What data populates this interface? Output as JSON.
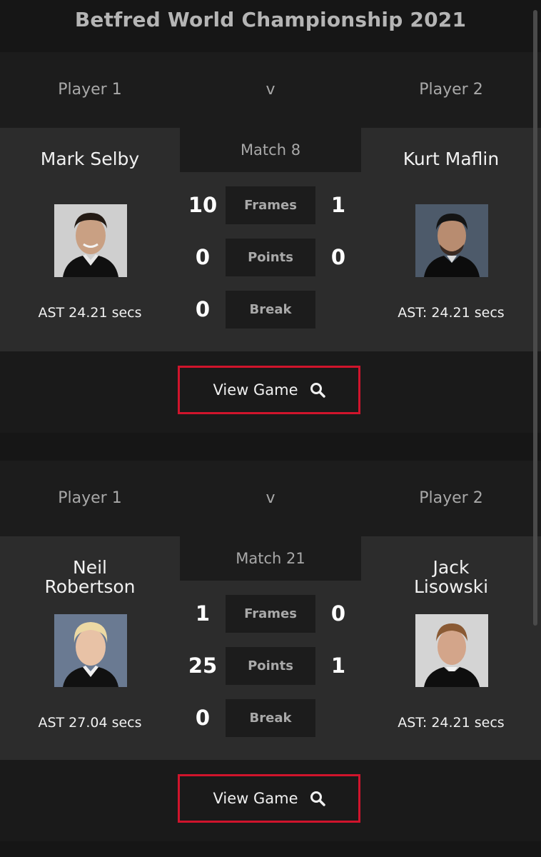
{
  "page": {
    "title": "Betfred World Championship 2021"
  },
  "matches": [
    {
      "header": {
        "player1_label": "Player 1",
        "versus": "v",
        "player2_label": "Player 2"
      },
      "match_label": "Match 8",
      "player1": {
        "name": "Mark Selby",
        "ast": "AST 24.21 secs",
        "avatar_icon": "player-photo-icon"
      },
      "player2": {
        "name": "Kurt Maflin",
        "ast": "AST: 24.21 secs",
        "avatar_icon": "player-photo-icon"
      },
      "stats": [
        {
          "label": "Frames",
          "p1": "10",
          "p2": "1"
        },
        {
          "label": "Points",
          "p1": "0",
          "p2": "0"
        },
        {
          "label": "Break",
          "p1": "0",
          "p2": ""
        }
      ],
      "button": {
        "label": "View Game",
        "icon": "search-icon"
      }
    },
    {
      "header": {
        "player1_label": "Player 1",
        "versus": "v",
        "player2_label": "Player 2"
      },
      "match_label": "Match 21",
      "player1": {
        "name": "Neil Robertson",
        "ast": "AST 27.04 secs",
        "avatar_icon": "player-photo-icon"
      },
      "player2": {
        "name": "Jack Lisowski",
        "ast": "AST: 24.21 secs",
        "avatar_icon": "player-photo-icon"
      },
      "stats": [
        {
          "label": "Frames",
          "p1": "1",
          "p2": "0"
        },
        {
          "label": "Points",
          "p1": "25",
          "p2": "1"
        },
        {
          "label": "Break",
          "p1": "0",
          "p2": ""
        }
      ],
      "button": {
        "label": "View Game",
        "icon": "search-icon"
      }
    }
  ],
  "colors": {
    "accent": "#d0142c",
    "background": "#161616",
    "panel": "#2c2c2c",
    "header": "#1c1c1c"
  }
}
